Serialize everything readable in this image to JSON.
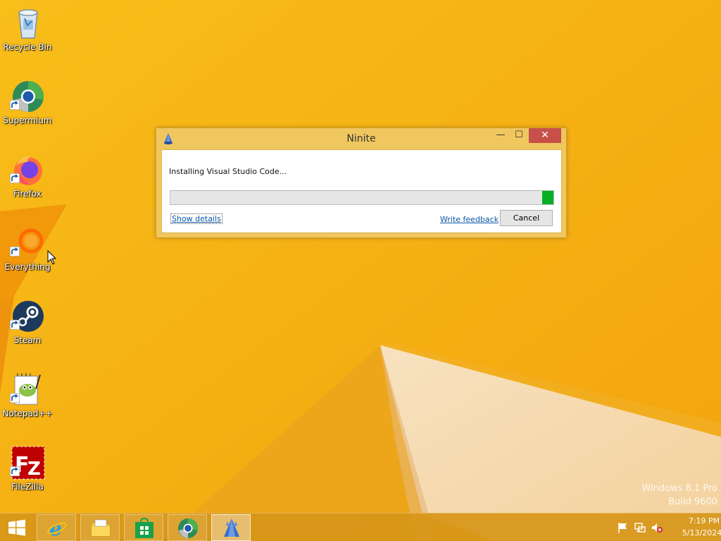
{
  "desktop": {
    "icons": [
      {
        "label": "Recycle Bin",
        "icon": "recycle-bin-icon"
      },
      {
        "label": "Supermium",
        "icon": "supermium-icon"
      },
      {
        "label": "Firefox",
        "icon": "firefox-icon"
      },
      {
        "label": "Everything",
        "icon": "everything-icon"
      },
      {
        "label": "Steam",
        "icon": "steam-icon"
      },
      {
        "label": "Notepad++",
        "icon": "notepadpp-icon"
      },
      {
        "label": "FileZilla",
        "icon": "filezilla-icon"
      }
    ],
    "watermark_line1": "Windows 8.1 Pro",
    "watermark_line2": "Build 9600"
  },
  "window": {
    "title": "Ninite",
    "minimize_glyph": "—",
    "maximize_glyph": "☐",
    "close_glyph": "✕",
    "status": "Installing Visual Studio Code...",
    "progress_fraction": 0.03,
    "progress_position": "right-end",
    "show_details_label": "Show details",
    "write_feedback_label": "Write feedback",
    "cancel_label": "Cancel"
  },
  "taskbar": {
    "items": [
      {
        "name": "internet-explorer",
        "icon": "internet-explorer-icon"
      },
      {
        "name": "file-explorer",
        "icon": "folder-icon"
      },
      {
        "name": "store",
        "icon": "store-icon"
      },
      {
        "name": "supermium",
        "icon": "supermium-icon"
      },
      {
        "name": "ninite",
        "icon": "ninite-icon",
        "active": true
      }
    ],
    "clock_time": "7:19 PM",
    "clock_date": "5/13/2024"
  },
  "colors": {
    "accent_progress": "#06b025",
    "close_button": "#c7504a",
    "wallpaper": "#f5b20e",
    "link": "#0b57a8"
  }
}
